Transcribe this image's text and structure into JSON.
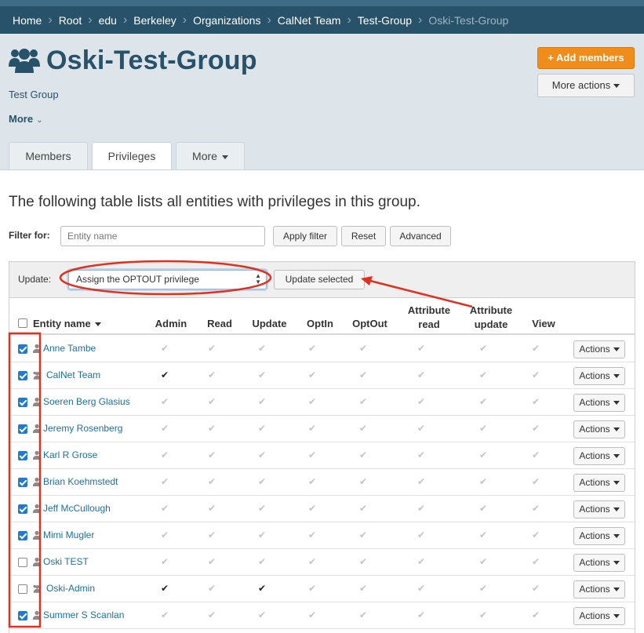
{
  "breadcrumb": [
    "Home",
    "Root",
    "edu",
    "Berkeley",
    "Organizations",
    "CalNet Team",
    "Test-Group",
    "Oski-Test-Group"
  ],
  "header": {
    "title": "Oski-Test-Group",
    "subtitle": "Test Group",
    "more_label": "More",
    "add_members_label": "+ Add members",
    "more_actions_label": "More actions"
  },
  "tabs": [
    "Members",
    "Privileges",
    "More"
  ],
  "active_tab": "Privileges",
  "intro_text": "The following table lists all entities with privileges in this group.",
  "filter": {
    "label": "Filter for:",
    "placeholder": "Entity name",
    "apply_label": "Apply filter",
    "reset_label": "Reset",
    "advanced_label": "Advanced"
  },
  "update": {
    "label": "Update:",
    "selected_option": "Assign the OPTOUT privilege",
    "button_label": "Update selected"
  },
  "table": {
    "columns": {
      "entity": "Entity name",
      "admin": "Admin",
      "read": "Read",
      "update": "Update",
      "optin": "OptIn",
      "optout": "OptOut",
      "attr_read_1": "Attribute",
      "attr_read_2": "read",
      "attr_update_1": "Attribute",
      "attr_update_2": "update",
      "view": "View"
    },
    "actions_label": "Actions",
    "rows": [
      {
        "name": "Anne Tambe",
        "type": "person",
        "checked": true,
        "privs": [
          false,
          false,
          false,
          false,
          false,
          false,
          false,
          false
        ]
      },
      {
        "name": "CalNet Team",
        "type": "group",
        "checked": true,
        "privs": [
          true,
          false,
          false,
          false,
          false,
          false,
          false,
          false
        ]
      },
      {
        "name": "Soeren Berg Glasius",
        "type": "person",
        "checked": true,
        "privs": [
          false,
          false,
          false,
          false,
          false,
          false,
          false,
          false
        ]
      },
      {
        "name": "Jeremy Rosenberg",
        "type": "person",
        "checked": true,
        "privs": [
          false,
          false,
          false,
          false,
          false,
          false,
          false,
          false
        ]
      },
      {
        "name": "Karl R Grose",
        "type": "person",
        "checked": true,
        "privs": [
          false,
          false,
          false,
          false,
          false,
          false,
          false,
          false
        ]
      },
      {
        "name": "Brian Koehmstedt",
        "type": "person",
        "checked": true,
        "privs": [
          false,
          false,
          false,
          false,
          false,
          false,
          false,
          false
        ]
      },
      {
        "name": "Jeff McCullough",
        "type": "person",
        "checked": true,
        "privs": [
          false,
          false,
          false,
          false,
          false,
          false,
          false,
          false
        ]
      },
      {
        "name": "Mimi Mugler",
        "type": "person",
        "checked": true,
        "privs": [
          false,
          false,
          false,
          false,
          false,
          false,
          false,
          false
        ]
      },
      {
        "name": "Oski TEST",
        "type": "person",
        "checked": false,
        "privs": [
          false,
          false,
          false,
          false,
          false,
          false,
          false,
          false
        ]
      },
      {
        "name": "Oski-Admin",
        "type": "group",
        "checked": false,
        "privs": [
          true,
          false,
          true,
          false,
          false,
          false,
          false,
          false
        ]
      },
      {
        "name": "Summer S Scanlan",
        "type": "person",
        "checked": true,
        "privs": [
          false,
          false,
          false,
          false,
          false,
          false,
          false,
          false
        ]
      }
    ]
  },
  "colors": {
    "brand": "#28526a",
    "accent": "#f08c1a",
    "link": "#1d6fa3",
    "annotation": "#e0301e"
  }
}
